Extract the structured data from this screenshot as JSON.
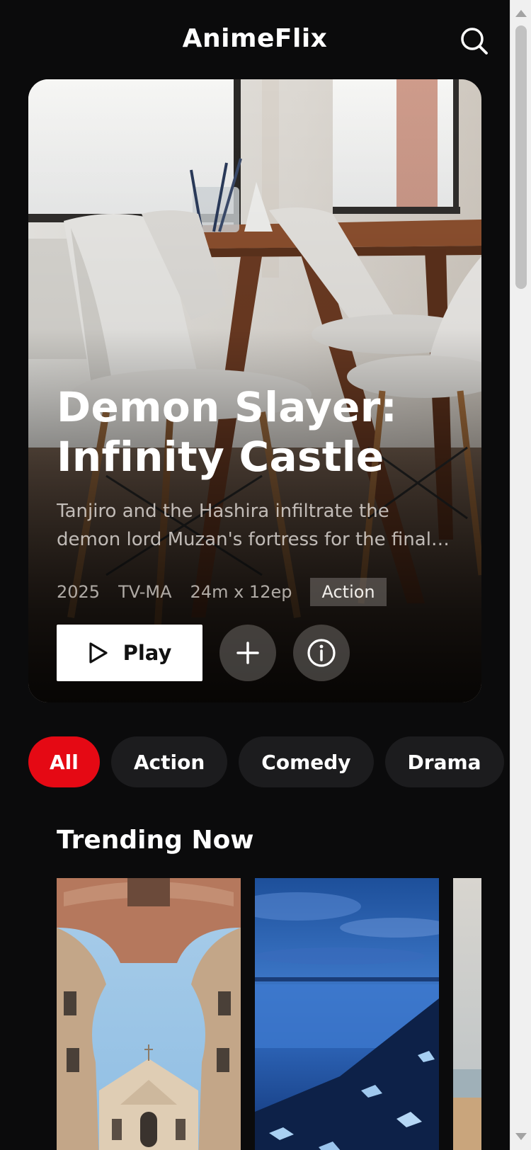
{
  "header": {
    "title": "AnimeFlix",
    "search_icon": "search-icon"
  },
  "hero": {
    "title_line1": "Demon Slayer:",
    "title_line2": "Infinity Castle",
    "desc_line1": "Tanjiro and the Hashira infiltrate the",
    "desc_line2": "demon lord Muzan's fortress for the final…",
    "year": "2025",
    "rating": "TV-MA",
    "duration": "24m x 12ep",
    "genre": "Action",
    "play_label": "Play",
    "add_icon": "plus-icon",
    "info_icon": "info-icon",
    "image": "dining room with white chairs and wooden table"
  },
  "categories": [
    {
      "label": "All",
      "active": true
    },
    {
      "label": "Action",
      "active": false
    },
    {
      "label": "Comedy",
      "active": false
    },
    {
      "label": "Drama",
      "active": false
    }
  ],
  "trending": {
    "title": "Trending Now",
    "cards": [
      {
        "image": "baroque church facade viewed from below"
      },
      {
        "image": "blue lake shore with ice at dusk"
      },
      {
        "image": "beach with sand and hazy sky"
      }
    ]
  },
  "colors": {
    "background": "#0b0b0c",
    "accent": "#e50914",
    "chip": "#1c1c1e"
  }
}
